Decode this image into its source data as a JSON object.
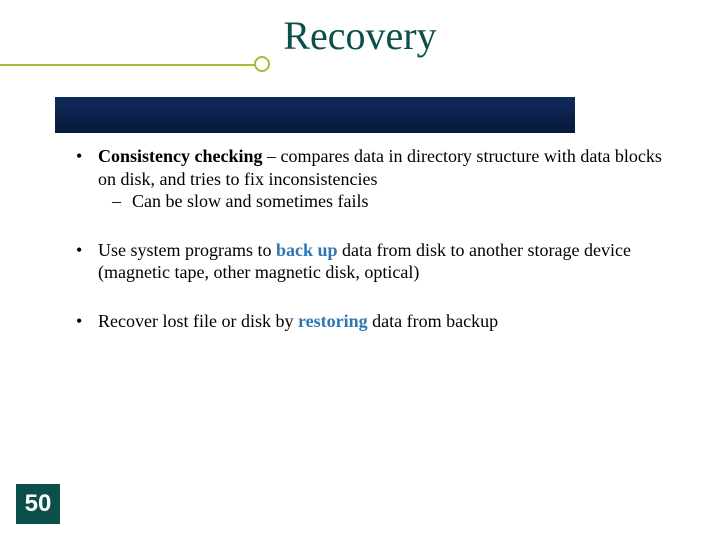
{
  "slide": {
    "title": "Recovery",
    "page_number": "50"
  },
  "bullets": {
    "b1": {
      "strong": "Consistency checking",
      "rest": " – compares data in directory structure with data blocks on disk, and tries to fix inconsistencies",
      "sub1": "Can be slow and sometimes fails"
    },
    "b2": {
      "pre": "Use system programs to ",
      "accent": "back up",
      "post": " data from disk to another storage device (magnetic tape, other magnetic disk, optical)"
    },
    "b3": {
      "pre": "Recover lost file or disk by ",
      "accent": "restoring",
      "post": " data from backup"
    }
  }
}
